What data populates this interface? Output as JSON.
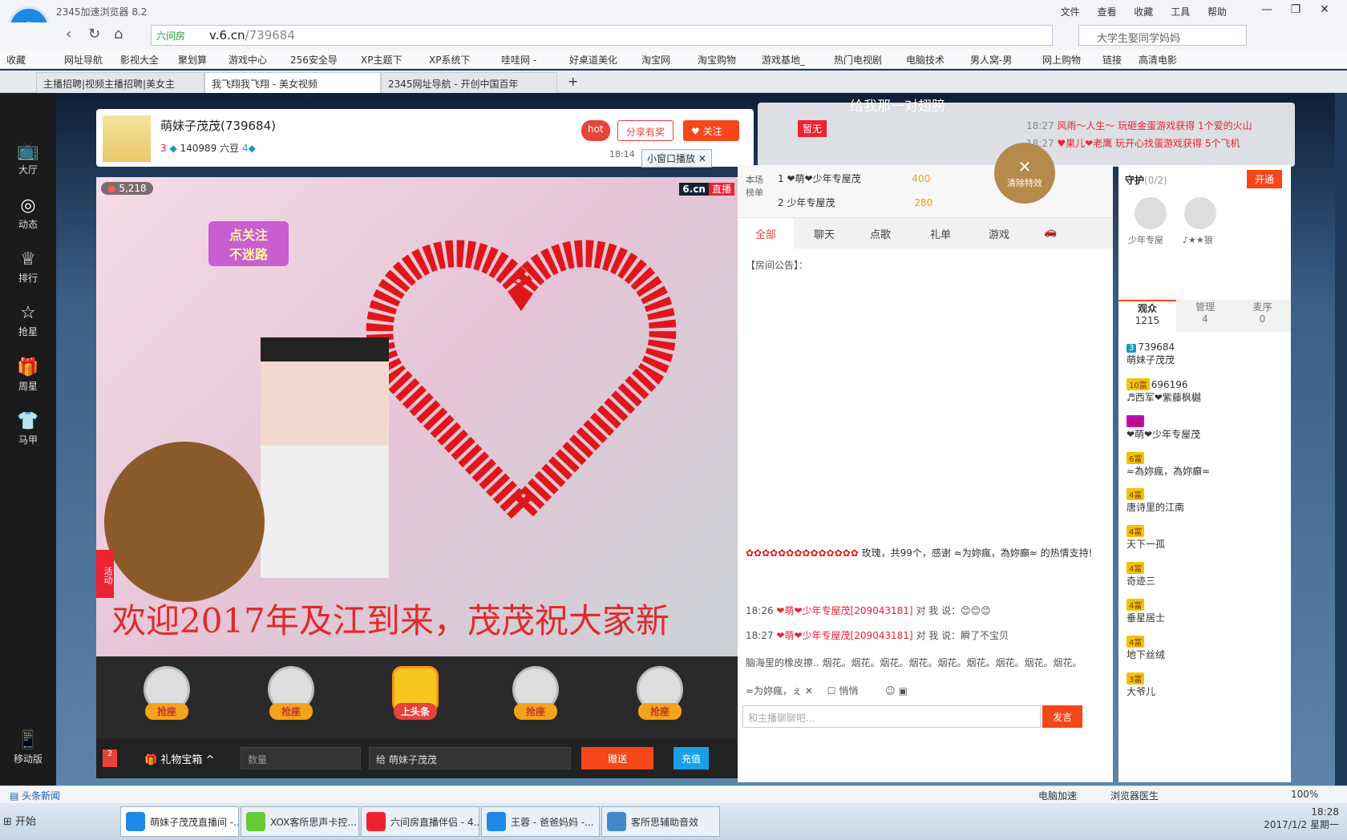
{
  "window": {
    "title": "2345加速浏览器 8.2",
    "menus": [
      "文件",
      "查看",
      "收藏",
      "工具",
      "帮助"
    ]
  },
  "address": {
    "security": "六间房",
    "url_domain": "v.6.cn",
    "url_path": "/739684",
    "search": "大学生娶同学妈妈"
  },
  "bookmarks": [
    "收藏",
    "网址导航",
    "影视大全",
    "聚划算",
    "游戏中心",
    "256安全导",
    "XP主题下",
    "XP系统下",
    "哇哇网 -",
    "好桌道美化",
    "淘宝网",
    "淘宝购物",
    "游戏基地_",
    "热门电视剧",
    "电脑技术",
    "男人窝-男",
    "网上购物",
    "链接",
    "高清电影"
  ],
  "tabs": [
    {
      "label": "主播招聘|视频主播招聘|美女主"
    },
    {
      "label": "我飞翔我飞翔 - 美女视频"
    },
    {
      "label": "2345网址导航 - 开创中国百年"
    }
  ],
  "banner": "给我那一对翅膀",
  "leftnav": [
    {
      "label": "大厅",
      "icon": "tv-icon"
    },
    {
      "label": "动态",
      "icon": "compass-icon"
    },
    {
      "label": "排行",
      "icon": "crown-icon"
    },
    {
      "label": "抢星",
      "icon": "star-icon"
    },
    {
      "label": "周星",
      "icon": "gift-icon"
    },
    {
      "label": "马甲",
      "icon": "shirt-icon"
    },
    {
      "label": "移动版",
      "icon": "phone-icon"
    }
  ],
  "anchor": {
    "name": "萌妹子茂茂(739684)",
    "level": "3",
    "beans": "140989 六豆",
    "level2": "4",
    "time": "18:14",
    "hot": "hot",
    "share": "分享有奖",
    "follow": "关注",
    "miniwin": "小窗口播放"
  },
  "video": {
    "viewers": "5,218",
    "brand": "6.cn",
    "live": "直播",
    "follow_sticker": [
      "点关注",
      "不迷路"
    ],
    "welcome": "欢迎2017年及江到来，茂茂祝大家新",
    "activity": "活动"
  },
  "seats": [
    {
      "label": "抢座"
    },
    {
      "label": "抢座"
    },
    {
      "label": "上头条"
    },
    {
      "label": "抢座"
    },
    {
      "label": "抢座"
    }
  ],
  "giftbar": {
    "gift_box": "礼物宝箱",
    "qty_placeholder": "数量",
    "to": "给",
    "to_name": "萌妹子茂茂",
    "send": "赠送",
    "recharge": "充值",
    "badge": "2"
  },
  "top": {
    "status": "暂无",
    "events": [
      {
        "time": "18:27",
        "text": "风雨～人生～ 玩砸金蛋游戏获得 1个爱的火山"
      },
      {
        "time": "18:27",
        "text": "♥果儿❤老鹰 玩开心找蛋游戏获得 5个飞机"
      }
    ],
    "clear": "清除特效"
  },
  "rank": {
    "title": "本场榜单",
    "rows": [
      {
        "no": "1",
        "name": "❤萌❤少年专屋茂",
        "value": "400"
      },
      {
        "no": "2",
        "name": "少年专屋茂",
        "value": "280"
      }
    ]
  },
  "chat_tabs": [
    "全部",
    "聊天",
    "点歌",
    "礼单",
    "游戏"
  ],
  "chat": {
    "notice": "【房间公告】：",
    "rose_text": "玫瑰，共99个，感谢 ≈为妳瘋，為妳癲≈ 的热情支持!",
    "msgs": [
      {
        "time": "18:26",
        "user": "❤萌❤少年专屋茂[209043181]",
        "text": "对 我 说：😊😊😊"
      },
      {
        "time": "18:27",
        "user": "❤萌❤少年专屋茂[209043181]",
        "text": "对 我 说：瞬了不宝贝"
      }
    ],
    "ticker": "脑海里的橡皮擦.. 烟花。烟花。烟花。烟花。烟花。烟花。烟花。烟花。烟花。",
    "target": "≈为妳瘋，ぇ",
    "whisper": "悄悄",
    "input_placeholder": "和主播聊聊吧...",
    "send": "发言"
  },
  "guard": {
    "title": "守护",
    "count": "(0/2)",
    "open": "开通",
    "members": [
      "少年专屋",
      "♪★★狼"
    ]
  },
  "audience": {
    "tabs": [
      {
        "label": "观众",
        "count": "1215"
      },
      {
        "label": "管理",
        "count": "4"
      },
      {
        "label": "麦序",
        "count": "0"
      }
    ],
    "users": [
      {
        "badge": "3",
        "id": "739684",
        "name": "萌妹子茂茂"
      },
      {
        "badge": "10富",
        "id": "696196",
        "name": "♬西军❤紫藤枫樾"
      },
      {
        "badge": "8富",
        "id": "",
        "name": "❤萌❤少年专屋茂"
      },
      {
        "badge": "6富",
        "id": "",
        "name": "≈為妳瘋，為妳癲≈"
      },
      {
        "badge": "4富",
        "id": "",
        "name": "唐诗里的江南"
      },
      {
        "badge": "4富",
        "id": "",
        "name": "天下一孤"
      },
      {
        "badge": "4富",
        "id": "",
        "name": "奇迹三"
      },
      {
        "badge": "4富",
        "id": "",
        "name": "垂星居士"
      },
      {
        "badge": "4富",
        "id": "",
        "name": "地下丝绒"
      },
      {
        "badge": "3富",
        "id": "",
        "name": "大爷儿"
      }
    ]
  },
  "statusbar": {
    "news": "头条新闻",
    "speed": "电脑加速",
    "doctor": "浏览器医生",
    "zoom": "100%"
  },
  "taskbar": {
    "start": "开始",
    "items": [
      "萌妹子茂茂直播间 -...",
      "XOX客所思声卡控...",
      "六间房直播伴侣 - 4...",
      "王蓉 - 爸爸妈妈 -...",
      "客所思辅助音效"
    ],
    "time": "18:28",
    "date": "2017/1/2 星期一"
  }
}
